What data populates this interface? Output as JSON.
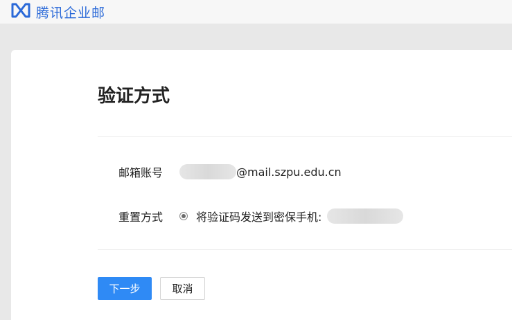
{
  "brand": {
    "name": "腾讯企业邮",
    "colors": {
      "brand": "#2a69d8",
      "primary": "#2f8af5",
      "background": "#e8e8e8"
    },
    "logo_icon": "tencent-exmail-logo-icon"
  },
  "verify": {
    "title": "验证方式",
    "account_label": "邮箱账号",
    "account_domain": "@mail.szpu.edu.cn",
    "method_label": "重置方式",
    "method_option": "将验证码发送到密保手机:",
    "method_selected": true
  },
  "actions": {
    "next_label": "下一步",
    "cancel_label": "取消"
  }
}
